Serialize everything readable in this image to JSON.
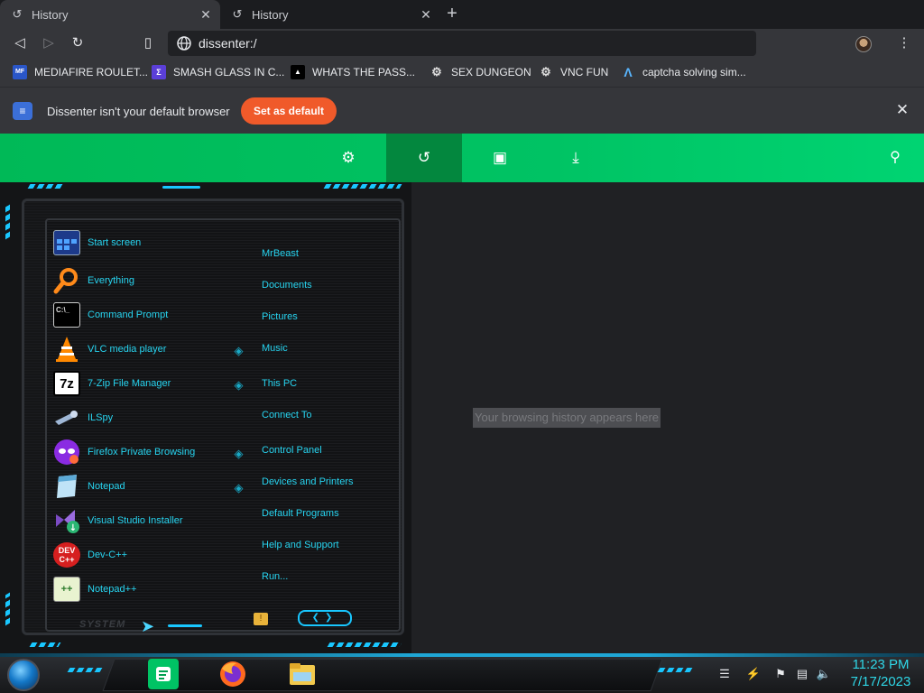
{
  "tabs": [
    {
      "title": "History",
      "active": true
    },
    {
      "title": "History",
      "active": false
    }
  ],
  "omnibox": {
    "url": "dissenter:/"
  },
  "bookmarks": [
    {
      "label": "MEDIAFIRE ROULET...",
      "icon_text": "MF"
    },
    {
      "label": "SMASH GLASS IN C...",
      "icon_text": "Σ"
    },
    {
      "label": "WHATS THE PASS...",
      "icon_text": "▲"
    },
    {
      "label": "SEX DUNGEON",
      "icon_text": "⚙"
    },
    {
      "label": "VNC FUN",
      "icon_text": "⚙"
    },
    {
      "label": "captcha solving sim...",
      "icon_text": "Λ"
    }
  ],
  "infobar": {
    "message": "Dissenter isn't your default browser",
    "button": "Set as default"
  },
  "history": {
    "empty_message": "Your browsing history appears here"
  },
  "startmenu": {
    "programs": [
      {
        "label": "Start screen",
        "icon": "start-screen-icon"
      },
      {
        "label": "Everything",
        "icon": "magnifier-icon"
      },
      {
        "label": "Command Prompt",
        "icon": "cmd-icon",
        "icon_text": "C:\\_"
      },
      {
        "label": "VLC media player",
        "icon": "vlc-cone-icon"
      },
      {
        "label": "7-Zip File Manager",
        "icon": "7zip-icon",
        "icon_text": "7z"
      },
      {
        "label": "ILSpy",
        "icon": "ilspy-icon"
      },
      {
        "label": "Firefox Private Browsing",
        "icon": "private-mask-icon"
      },
      {
        "label": "Notepad",
        "icon": "notepad-icon"
      },
      {
        "label": "Visual Studio Installer",
        "icon": "vs-installer-icon"
      },
      {
        "label": "Dev-C++",
        "icon": "devcpp-icon",
        "icon_text": "DEV C++"
      },
      {
        "label": "Notepad++",
        "icon": "notepadpp-icon",
        "icon_text": "++"
      }
    ],
    "places": [
      {
        "label": "MrBeast",
        "arrow": false
      },
      {
        "label": "Documents",
        "arrow": false
      },
      {
        "label": "Pictures",
        "arrow": false
      },
      {
        "label": "Music",
        "arrow": true
      },
      {
        "label": "This PC",
        "arrow": true
      },
      {
        "label": "Connect To",
        "arrow": false
      },
      {
        "label": "Control Panel",
        "arrow": true
      },
      {
        "label": "Devices and Printers",
        "arrow": true
      },
      {
        "label": "Default Programs",
        "arrow": false
      },
      {
        "label": "Help and Support",
        "arrow": false
      },
      {
        "label": "Run...",
        "arrow": false
      }
    ],
    "system_label": "SYSTEM"
  },
  "taskbar": {
    "time": "11:23 PM",
    "date": "7/17/2023"
  },
  "colors": {
    "accent_green": "#00c364",
    "set_default": "#f05a2a",
    "cyan": "#27d4f0"
  }
}
